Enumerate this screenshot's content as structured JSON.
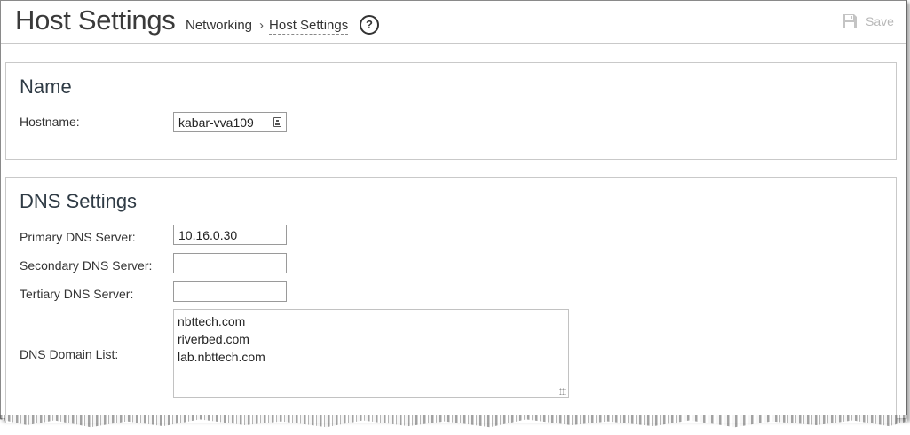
{
  "header": {
    "title": "Host Settings",
    "breadcrumb": [
      "Networking",
      "Host Settings"
    ],
    "breadcrumb_separator": "›",
    "help_icon": "question-circle-icon",
    "help_glyph": "?",
    "save_label": "Save",
    "save_icon": "floppy-disk-icon"
  },
  "name_section": {
    "title": "Name",
    "hostname_label": "Hostname:",
    "hostname_value": "kabar-vva109"
  },
  "dns_section": {
    "title": "DNS Settings",
    "primary_label": "Primary DNS Server:",
    "primary_value": "10.16.0.30",
    "secondary_label": "Secondary DNS Server:",
    "secondary_value": "",
    "tertiary_label": "Tertiary DNS Server:",
    "tertiary_value": "",
    "domain_list_label": "DNS Domain List:",
    "domain_list": [
      "nbttech.com",
      "riverbed.com",
      "lab.nbttech.com"
    ]
  },
  "colors": {
    "title_text": "#3a3a3a",
    "section_title": "#2f3b45",
    "disabled_save": "#b8b8b8",
    "panel_border": "#c9c9c9"
  }
}
